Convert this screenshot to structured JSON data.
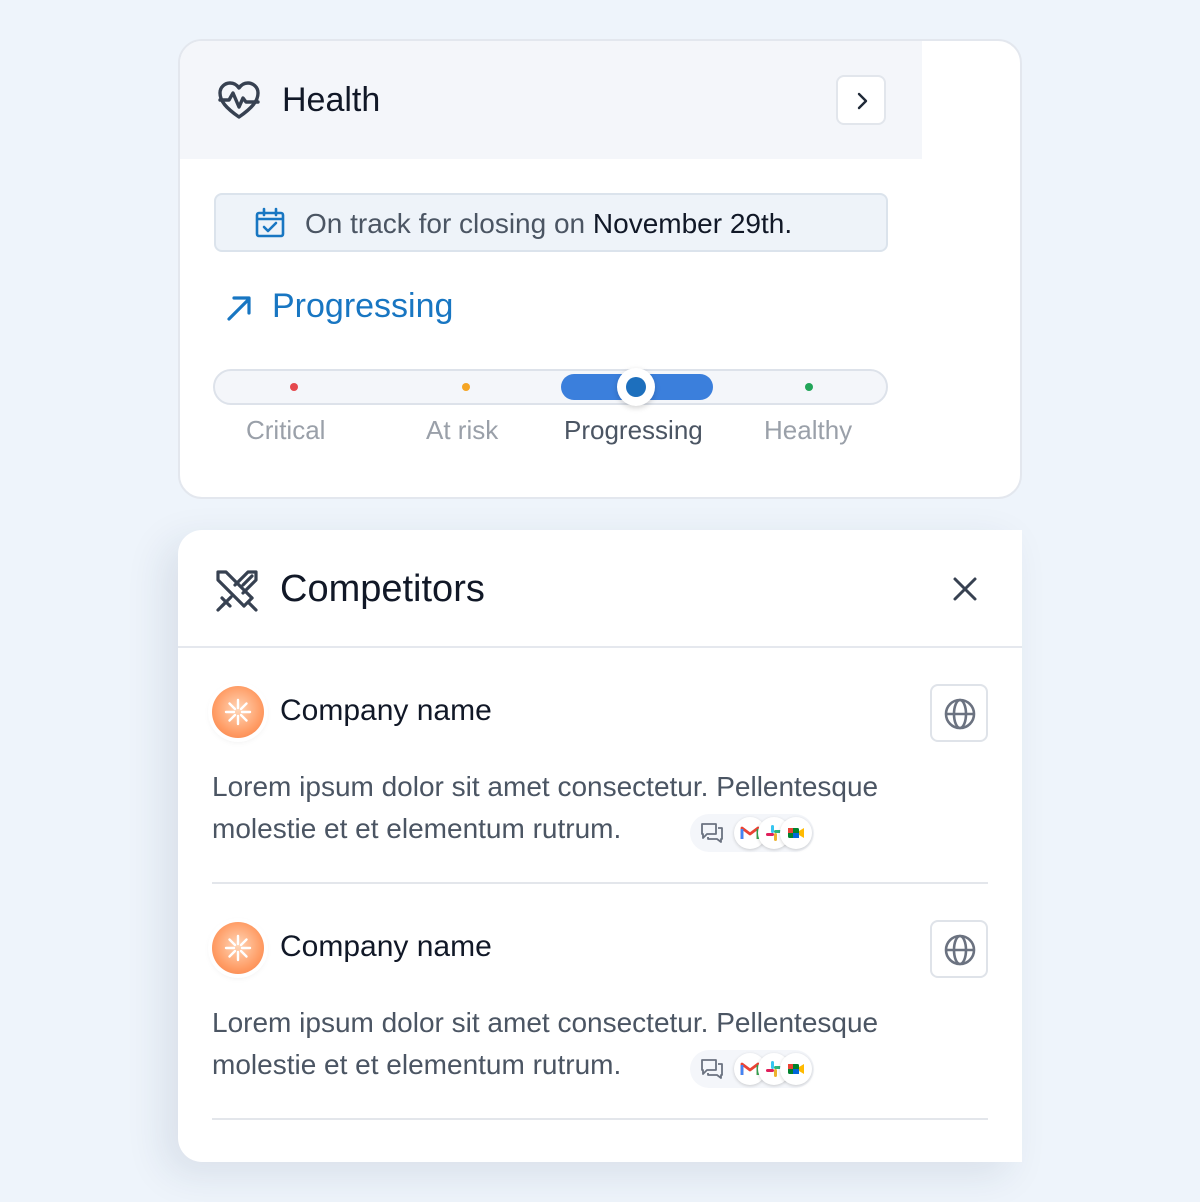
{
  "health": {
    "title": "Health",
    "icon": "heart-pulse-icon",
    "banner_prefix": "On track for closing on ",
    "banner_date": "November 29th.",
    "status": "Progressing",
    "status_color": "#1876c2",
    "scale": [
      {
        "label": "Critical",
        "color": "#e5484d"
      },
      {
        "label": "At risk",
        "color": "#f5a524"
      },
      {
        "label": "Progressing",
        "color": "#3b7fdc",
        "active": true
      },
      {
        "label": "Healthy",
        "color": "#22a559"
      }
    ]
  },
  "competitors": {
    "title": "Competitors",
    "icon": "crossed-swords-icon",
    "items": [
      {
        "name": "Company name",
        "description": "Lorem ipsum dolor sit amet consectetur. Pellentesque molestie et et elementum rutrum.",
        "sources": [
          "gmail-icon",
          "slack-icon",
          "google-meet-icon"
        ]
      },
      {
        "name": "Company name",
        "description": "Lorem ipsum dolor sit amet consectetur. Pellentesque molestie et et elementum rutrum.",
        "sources": [
          "gmail-icon",
          "slack-icon",
          "google-meet-icon"
        ]
      }
    ]
  }
}
